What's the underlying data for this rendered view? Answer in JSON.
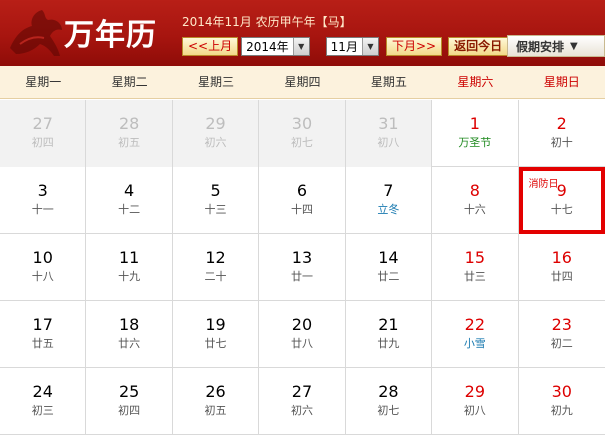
{
  "header": {
    "logo": "万年历",
    "date_info": "2014年11月 农历甲午年【马】",
    "prev_label": "<<上月",
    "next_label": "下月>>",
    "year_value": "2014年",
    "month_value": "11月",
    "today_label": "返回今日",
    "holiday_label": "假期安排",
    "horse_icon": "horse-icon"
  },
  "weekdays": [
    "星期一",
    "星期二",
    "星期三",
    "星期四",
    "星期五",
    "星期六",
    "星期日"
  ],
  "colors": {
    "header_red": "#a7150f",
    "weekend_red": "#d00000",
    "today_border": "#e30000",
    "festival_green": "#1f8a1f",
    "term_blue": "#1a7ab0"
  },
  "weeks": [
    [
      {
        "day": "27",
        "lunar": "初四",
        "other": true
      },
      {
        "day": "28",
        "lunar": "初五",
        "other": true
      },
      {
        "day": "29",
        "lunar": "初六",
        "other": true
      },
      {
        "day": "30",
        "lunar": "初七",
        "other": true
      },
      {
        "day": "31",
        "lunar": "初八",
        "other": true
      },
      {
        "day": "1",
        "lunar": "万圣节",
        "weekend": true,
        "festival": true
      },
      {
        "day": "2",
        "lunar": "初十",
        "weekend": true
      }
    ],
    [
      {
        "day": "3",
        "lunar": "十一"
      },
      {
        "day": "4",
        "lunar": "十二"
      },
      {
        "day": "5",
        "lunar": "十三"
      },
      {
        "day": "6",
        "lunar": "十四"
      },
      {
        "day": "7",
        "lunar": "立冬",
        "term": true
      },
      {
        "day": "8",
        "lunar": "十六",
        "weekend": true
      },
      {
        "day": "9",
        "lunar": "十七",
        "weekend": true,
        "today": true,
        "tag": "消防日"
      }
    ],
    [
      {
        "day": "10",
        "lunar": "十八"
      },
      {
        "day": "11",
        "lunar": "十九"
      },
      {
        "day": "12",
        "lunar": "二十"
      },
      {
        "day": "13",
        "lunar": "廿一"
      },
      {
        "day": "14",
        "lunar": "廿二"
      },
      {
        "day": "15",
        "lunar": "廿三",
        "weekend": true
      },
      {
        "day": "16",
        "lunar": "廿四",
        "weekend": true
      }
    ],
    [
      {
        "day": "17",
        "lunar": "廿五"
      },
      {
        "day": "18",
        "lunar": "廿六"
      },
      {
        "day": "19",
        "lunar": "廿七"
      },
      {
        "day": "20",
        "lunar": "廿八"
      },
      {
        "day": "21",
        "lunar": "廿九"
      },
      {
        "day": "22",
        "lunar": "小雪",
        "weekend": true,
        "term": true
      },
      {
        "day": "23",
        "lunar": "初二",
        "weekend": true
      }
    ],
    [
      {
        "day": "24",
        "lunar": "初三"
      },
      {
        "day": "25",
        "lunar": "初四"
      },
      {
        "day": "26",
        "lunar": "初五"
      },
      {
        "day": "27",
        "lunar": "初六"
      },
      {
        "day": "28",
        "lunar": "初七"
      },
      {
        "day": "29",
        "lunar": "初八",
        "weekend": true
      },
      {
        "day": "30",
        "lunar": "初九",
        "weekend": true
      }
    ]
  ]
}
